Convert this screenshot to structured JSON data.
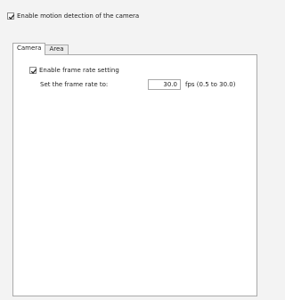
{
  "motion_detection": {
    "label": "Enable motion detection of the camera",
    "checked": true
  },
  "tabs": [
    {
      "label": "Camera",
      "active": true
    },
    {
      "label": "Area",
      "active": false
    }
  ],
  "camera": {
    "frame_rate_enabled": {
      "label": "Enable frame rate setting",
      "checked": true
    },
    "set_rate_label": "Set the frame rate to:",
    "rate_value": "30.0",
    "rate_unit_range": "fps (0.5 to 30.0)"
  },
  "icons": {
    "checkbox_check": "check-icon"
  }
}
